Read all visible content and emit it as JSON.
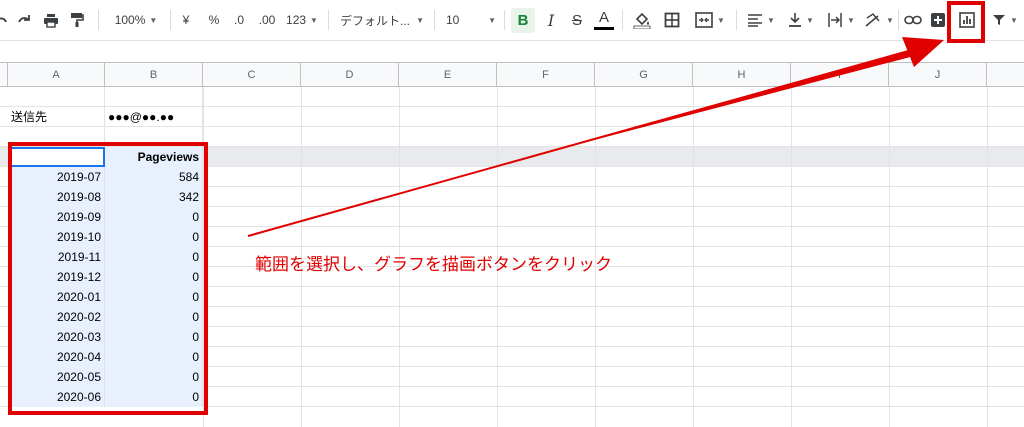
{
  "toolbar": {
    "zoom": "100%",
    "currency": "¥",
    "percent": "%",
    "dec_decrease": ".0",
    "dec_increase": ".00",
    "number_format": "123",
    "font": "デフォルト...",
    "font_size": "10",
    "bold": "B",
    "italic": "I",
    "strike": "S",
    "text_color": "A"
  },
  "columns": [
    "A",
    "B",
    "C",
    "D",
    "E",
    "F",
    "G",
    "H",
    "I",
    "J"
  ],
  "send_label": "送信先",
  "send_value": "●●●@●●.●●",
  "table": {
    "header": "Pageviews",
    "rows": [
      {
        "month": "2019-07",
        "value": "584"
      },
      {
        "month": "2019-08",
        "value": "342"
      },
      {
        "month": "2019-09",
        "value": "0"
      },
      {
        "month": "2019-10",
        "value": "0"
      },
      {
        "month": "2019-11",
        "value": "0"
      },
      {
        "month": "2019-12",
        "value": "0"
      },
      {
        "month": "2020-01",
        "value": "0"
      },
      {
        "month": "2020-02",
        "value": "0"
      },
      {
        "month": "2020-03",
        "value": "0"
      },
      {
        "month": "2020-04",
        "value": "0"
      },
      {
        "month": "2020-05",
        "value": "0"
      },
      {
        "month": "2020-06",
        "value": "0"
      }
    ]
  },
  "annotation": "範囲を選択し、グラフを描画ボタンをクリック",
  "colors": {
    "highlight": "#e00000",
    "selection": "#e8f0fe",
    "bold_active": "#188038"
  }
}
